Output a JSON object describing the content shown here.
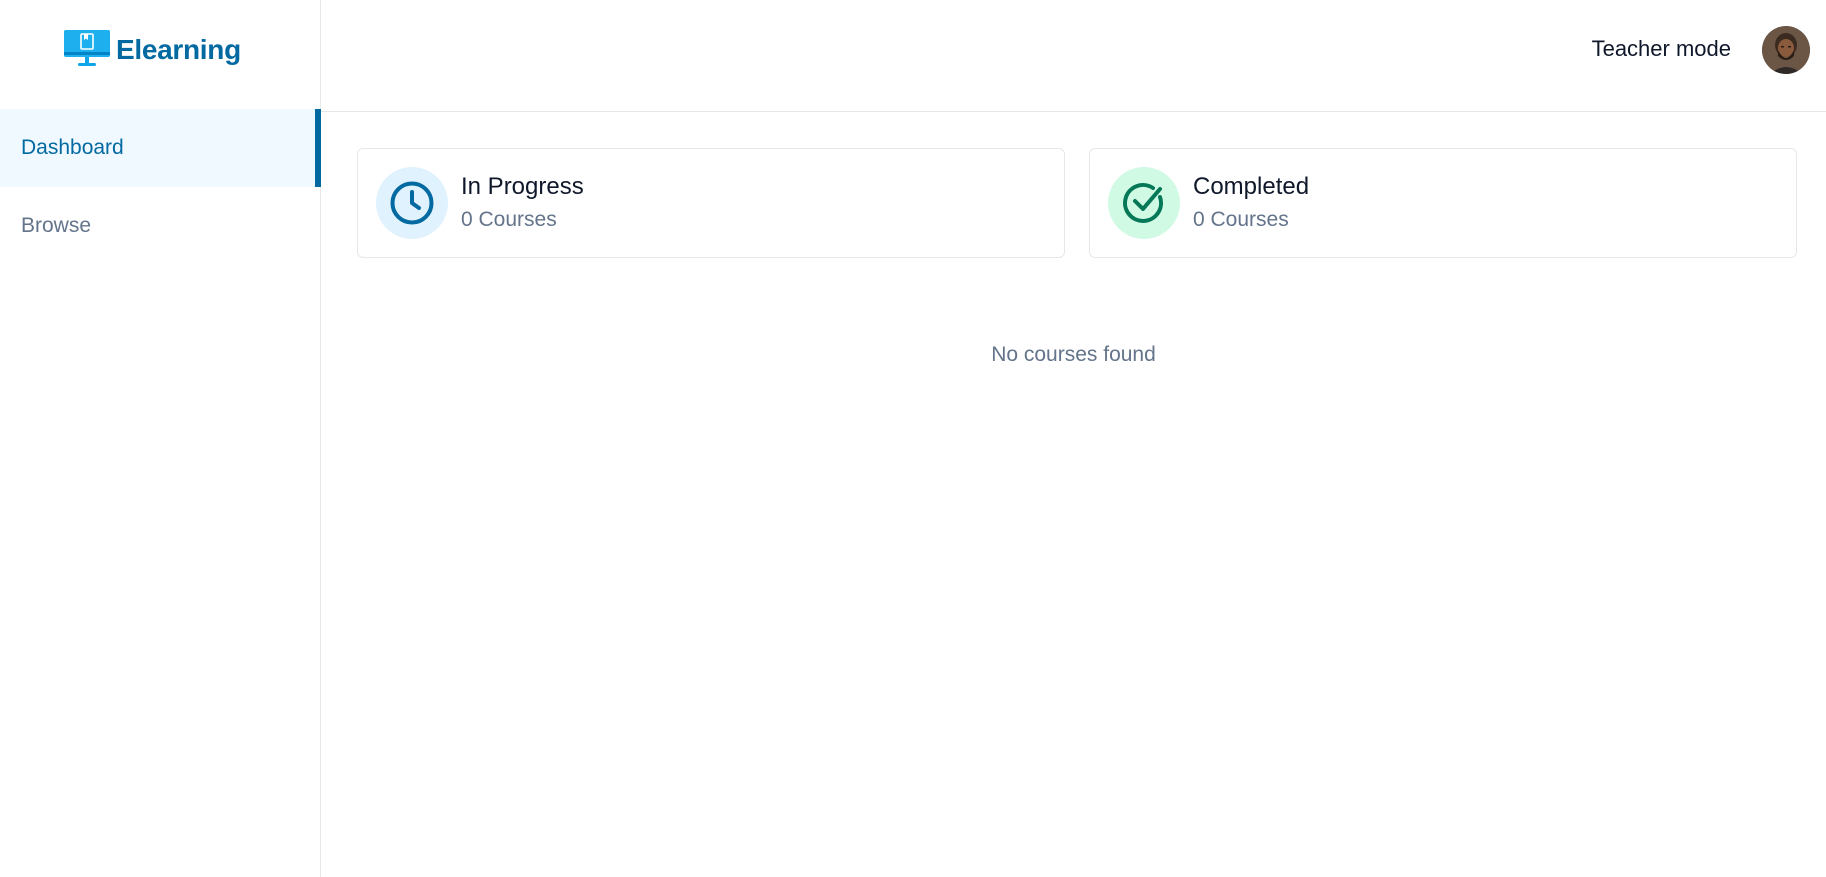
{
  "brand": {
    "name": "Elearning",
    "color": "#0369a1",
    "icon": "monitor-book-icon"
  },
  "sidebar": {
    "items": [
      {
        "label": "Dashboard",
        "active": true
      },
      {
        "label": "Browse",
        "active": false
      }
    ]
  },
  "header": {
    "teacher_mode_label": "Teacher mode",
    "avatar_icon": "user-avatar"
  },
  "stats": {
    "in_progress": {
      "title": "In Progress",
      "count_text": "0 Courses",
      "icon": "clock-icon",
      "color": "#0369a1"
    },
    "completed": {
      "title": "Completed",
      "count_text": "0 Courses",
      "icon": "check-circle-icon",
      "color": "#047857"
    }
  },
  "empty_state": "No courses found"
}
